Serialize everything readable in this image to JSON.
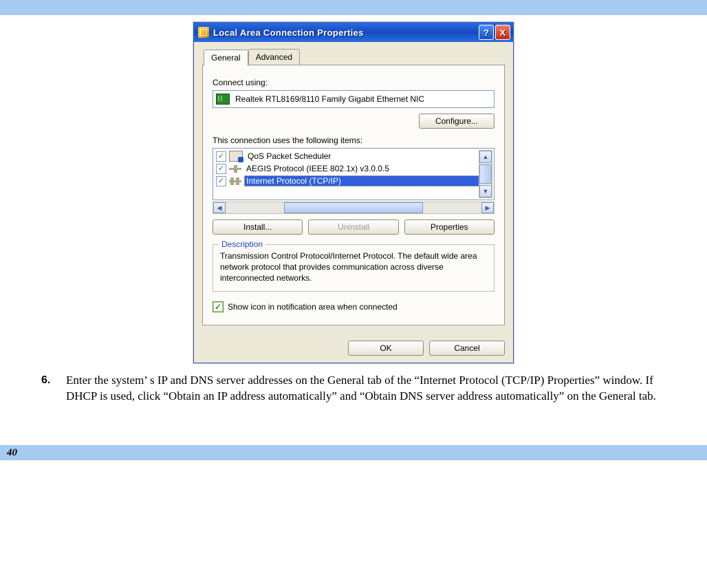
{
  "page": {
    "number": "40"
  },
  "dialog": {
    "title": "Local Area Connection Properties",
    "help_glyph": "?",
    "close_glyph": "X",
    "tabs": {
      "general": "General",
      "advanced": "Advanced"
    },
    "connect_using_label": "Connect using:",
    "adapter_name": "Realtek RTL8169/8110 Family Gigabit Ethernet NIC",
    "configure_btn": "Configure...",
    "items_label": "This connection uses the following items:",
    "items": [
      {
        "label": "QoS Packet Scheduler",
        "checked": true,
        "selected": false,
        "icon": "qos"
      },
      {
        "label": "AEGIS Protocol (IEEE 802.1x) v3.0.0.5",
        "checked": true,
        "selected": false,
        "icon": "aegis"
      },
      {
        "label": "Internet Protocol (TCP/IP)",
        "checked": true,
        "selected": true,
        "icon": "tcpip"
      }
    ],
    "install_btn": "Install...",
    "uninstall_btn": "Uninstall",
    "properties_btn": "Properties",
    "description_legend": "Description",
    "description_text": "Transmission Control Protocol/Internet Protocol. The default wide area network protocol that provides communication across diverse interconnected networks.",
    "show_icon_label": "Show icon in notification area when connected",
    "ok_btn": "OK",
    "cancel_btn": "Cancel"
  },
  "instruction": {
    "number": "6.",
    "text": "Enter the system’ s IP and DNS server addresses on the General tab of the “Internet Protocol (TCP/IP) Properties” window.  If DHCP is used, click “Obtain an IP address automatically” and “Obtain DNS server address automatically” on the General tab."
  }
}
